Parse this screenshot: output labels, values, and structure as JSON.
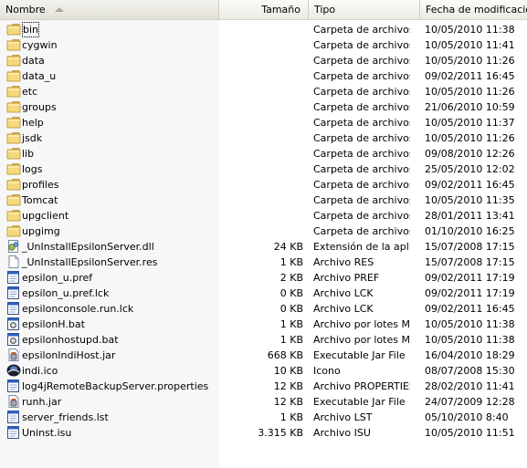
{
  "columns": {
    "name": "Nombre",
    "size": "Tamaño",
    "type": "Tipo",
    "date": "Fecha de modificación"
  },
  "files": [
    {
      "name": "bin",
      "size": "",
      "type": "Carpeta de archivos",
      "date": "10/05/2010 11:38",
      "icon": "folder-icon"
    },
    {
      "name": "cygwin",
      "size": "",
      "type": "Carpeta de archivos",
      "date": "10/05/2010 11:41",
      "icon": "folder-icon"
    },
    {
      "name": "data",
      "size": "",
      "type": "Carpeta de archivos",
      "date": "10/05/2010 11:26",
      "icon": "folder-icon"
    },
    {
      "name": "data_u",
      "size": "",
      "type": "Carpeta de archivos",
      "date": "09/02/2011 16:45",
      "icon": "folder-icon"
    },
    {
      "name": "etc",
      "size": "",
      "type": "Carpeta de archivos",
      "date": "10/05/2010 11:26",
      "icon": "folder-icon"
    },
    {
      "name": "groups",
      "size": "",
      "type": "Carpeta de archivos",
      "date": "21/06/2010 10:59",
      "icon": "folder-icon"
    },
    {
      "name": "help",
      "size": "",
      "type": "Carpeta de archivos",
      "date": "10/05/2010 11:37",
      "icon": "folder-icon"
    },
    {
      "name": "jsdk",
      "size": "",
      "type": "Carpeta de archivos",
      "date": "10/05/2010 11:26",
      "icon": "folder-icon"
    },
    {
      "name": "lib",
      "size": "",
      "type": "Carpeta de archivos",
      "date": "09/08/2010 12:26",
      "icon": "folder-icon"
    },
    {
      "name": "logs",
      "size": "",
      "type": "Carpeta de archivos",
      "date": "25/05/2010 12:02",
      "icon": "folder-icon"
    },
    {
      "name": "profiles",
      "size": "",
      "type": "Carpeta de archivos",
      "date": "09/02/2011 16:45",
      "icon": "folder-icon"
    },
    {
      "name": "Tomcat",
      "size": "",
      "type": "Carpeta de archivos",
      "date": "10/05/2010 11:35",
      "icon": "folder-icon"
    },
    {
      "name": "upgclient",
      "size": "",
      "type": "Carpeta de archivos",
      "date": "28/01/2011 13:41",
      "icon": "folder-icon"
    },
    {
      "name": "upgimg",
      "size": "",
      "type": "Carpeta de archivos",
      "date": "01/10/2010 16:25",
      "icon": "folder-icon"
    },
    {
      "name": "_UnInstallEpsilonServer.dll",
      "size": "24 KB",
      "type": "Extensión de la apli...",
      "date": "15/07/2008 17:15",
      "icon": "dll-icon"
    },
    {
      "name": "_UnInstallEpsilonServer.res",
      "size": "1 KB",
      "type": "Archivo RES",
      "date": "15/07/2008 17:15",
      "icon": "blank-file-icon"
    },
    {
      "name": "epsilon_u.pref",
      "size": "2 KB",
      "type": "Archivo PREF",
      "date": "09/02/2011 17:19",
      "icon": "window-file-icon"
    },
    {
      "name": "epsilon_u.pref.lck",
      "size": "0 KB",
      "type": "Archivo LCK",
      "date": "09/02/2011 17:19",
      "icon": "window-file-icon"
    },
    {
      "name": "epsilonconsole.run.lck",
      "size": "0 KB",
      "type": "Archivo LCK",
      "date": "09/02/2011 16:45",
      "icon": "window-file-icon"
    },
    {
      "name": "epsilonH.bat",
      "size": "1 KB",
      "type": "Archivo por lotes M...",
      "date": "10/05/2010 11:38",
      "icon": "batch-file-icon"
    },
    {
      "name": "epsilonhostupd.bat",
      "size": "1 KB",
      "type": "Archivo por lotes M...",
      "date": "10/05/2010 11:38",
      "icon": "batch-file-icon"
    },
    {
      "name": "epsilonIndiHost.jar",
      "size": "668 KB",
      "type": "Executable Jar File",
      "date": "16/04/2010 18:29",
      "icon": "jar-file-icon"
    },
    {
      "name": "indi.ico",
      "size": "10 KB",
      "type": "Icono",
      "date": "08/07/2008 15:30",
      "icon": "ico-file-icon"
    },
    {
      "name": "log4jRemoteBackupServer.properties",
      "size": "12 KB",
      "type": "Archivo PROPERTIES",
      "date": "28/02/2010 11:41",
      "icon": "window-file-icon"
    },
    {
      "name": "runh.jar",
      "size": "12 KB",
      "type": "Executable Jar File",
      "date": "24/07/2009 12:28",
      "icon": "jar-file-icon"
    },
    {
      "name": "server_friends.lst",
      "size": "1 KB",
      "type": "Archivo LST",
      "date": "05/10/2010 8:40",
      "icon": "window-file-icon"
    },
    {
      "name": "Uninst.isu",
      "size": "3.315 KB",
      "type": "Archivo ISU",
      "date": "10/05/2010 11:51",
      "icon": "window-file-icon"
    }
  ]
}
